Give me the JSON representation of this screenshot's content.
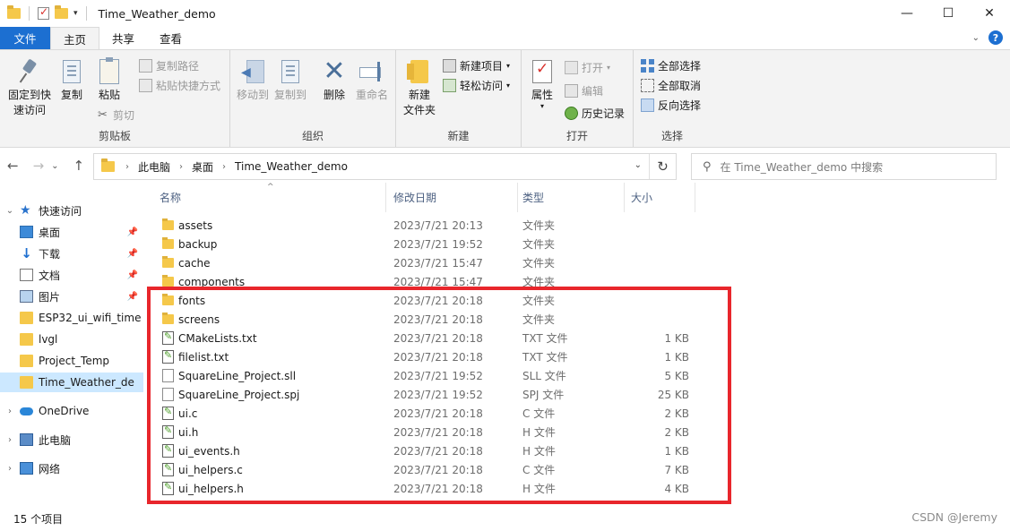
{
  "window": {
    "title": "Time_Weather_demo",
    "controls": [
      "—",
      "☐",
      "✕"
    ]
  },
  "tabs": [
    {
      "label": "文件"
    },
    {
      "label": "主页"
    },
    {
      "label": "共享"
    },
    {
      "label": "查看"
    }
  ],
  "ribbon": {
    "clipboard": {
      "label": "剪贴板",
      "pin_quick": "固定到快\n速访问",
      "copy": "复制",
      "paste": "粘贴",
      "copy_path": "复制路径",
      "paste_shortcut": "粘贴快捷方式",
      "cut": "剪切"
    },
    "organize": {
      "label": "组织",
      "move_to": "移动到",
      "copy_to": "复制到",
      "delete": "删除",
      "rename": "重命名"
    },
    "new": {
      "label": "新建",
      "new_folder": "新建\n文件夹",
      "new_item": "新建项目",
      "easy_access": "轻松访问"
    },
    "open": {
      "label": "打开",
      "properties": "属性",
      "open": "打开",
      "edit": "编辑",
      "history": "历史记录"
    },
    "select": {
      "label": "选择",
      "select_all": "全部选择",
      "select_none": "全部取消",
      "invert": "反向选择"
    }
  },
  "address": {
    "crumbs": [
      "此电脑",
      "桌面",
      "Time_Weather_demo"
    ],
    "search_placeholder": "在 Time_Weather_demo 中搜索"
  },
  "nav": {
    "quick_access": "快速访问",
    "items": [
      {
        "label": "桌面",
        "pinned": true
      },
      {
        "label": "下载",
        "pinned": true
      },
      {
        "label": "文档",
        "pinned": true
      },
      {
        "label": "图片",
        "pinned": true
      },
      {
        "label": "ESP32_ui_wifi_time",
        "pinned": false
      },
      {
        "label": "lvgl",
        "pinned": false
      },
      {
        "label": "Project_Temp",
        "pinned": false
      },
      {
        "label": "Time_Weather_de",
        "pinned": false
      }
    ],
    "onedrive": "OneDrive",
    "this_pc": "此电脑",
    "network": "网络"
  },
  "columns": {
    "name": "名称",
    "date": "修改日期",
    "type": "类型",
    "size": "大小"
  },
  "files": [
    {
      "name": "assets",
      "date": "2023/7/21 20:13",
      "type": "文件夹",
      "size": "",
      "icon": "folder"
    },
    {
      "name": "backup",
      "date": "2023/7/21 19:52",
      "type": "文件夹",
      "size": "",
      "icon": "folder"
    },
    {
      "name": "cache",
      "date": "2023/7/21 15:47",
      "type": "文件夹",
      "size": "",
      "icon": "folder"
    },
    {
      "name": "components",
      "date": "2023/7/21 15:47",
      "type": "文件夹",
      "size": "",
      "icon": "folder"
    },
    {
      "name": "fonts",
      "date": "2023/7/21 20:18",
      "type": "文件夹",
      "size": "",
      "icon": "folder"
    },
    {
      "name": "screens",
      "date": "2023/7/21 20:18",
      "type": "文件夹",
      "size": "",
      "icon": "folder"
    },
    {
      "name": "CMakeLists.txt",
      "date": "2023/7/21 20:18",
      "type": "TXT 文件",
      "size": "1 KB",
      "icon": "note"
    },
    {
      "name": "filelist.txt",
      "date": "2023/7/21 20:18",
      "type": "TXT 文件",
      "size": "1 KB",
      "icon": "note"
    },
    {
      "name": "SquareLine_Project.sll",
      "date": "2023/7/21 19:52",
      "type": "SLL 文件",
      "size": "5 KB",
      "icon": "blank"
    },
    {
      "name": "SquareLine_Project.spj",
      "date": "2023/7/21 19:52",
      "type": "SPJ 文件",
      "size": "25 KB",
      "icon": "blank"
    },
    {
      "name": "ui.c",
      "date": "2023/7/21 20:18",
      "type": "C 文件",
      "size": "2 KB",
      "icon": "note"
    },
    {
      "name": "ui.h",
      "date": "2023/7/21 20:18",
      "type": "H 文件",
      "size": "2 KB",
      "icon": "note"
    },
    {
      "name": "ui_events.h",
      "date": "2023/7/21 20:18",
      "type": "H 文件",
      "size": "1 KB",
      "icon": "note"
    },
    {
      "name": "ui_helpers.c",
      "date": "2023/7/21 20:18",
      "type": "C 文件",
      "size": "7 KB",
      "icon": "note"
    },
    {
      "name": "ui_helpers.h",
      "date": "2023/7/21 20:18",
      "type": "H 文件",
      "size": "4 KB",
      "icon": "note"
    }
  ],
  "status": {
    "count": "15 个项目",
    "watermark": "CSDN @Jeremy"
  },
  "colors": {
    "file_tab": "#1c6fd1",
    "highlight_box": "#e8262c",
    "selected_nav": "#cce8ff"
  }
}
